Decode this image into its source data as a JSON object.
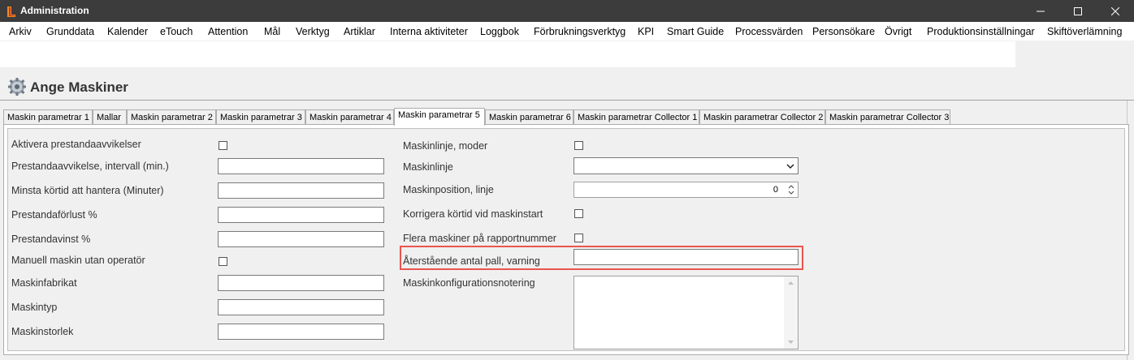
{
  "window": {
    "title": "Administration"
  },
  "menu": {
    "items": [
      "Arkiv",
      "Grunddata",
      "Kalender",
      "eTouch",
      "Attention",
      "Mål",
      "Verktyg",
      "Artiklar",
      "Interna aktiviteter",
      "Loggbok",
      "Förbrukningsverktyg",
      "KPI",
      "Smart Guide",
      "Processvärden",
      "Personsökare",
      "Övrigt",
      "Produktionsinställningar",
      "Skiftöverlämning"
    ]
  },
  "page": {
    "title": "Ange Maskiner"
  },
  "tabs": {
    "items": [
      "Maskin parametrar 1",
      "Mallar",
      "Maskin parametrar 2",
      "Maskin parametrar 3",
      "Maskin parametrar 4",
      "Maskin parametrar 5",
      "Maskin parametrar 6",
      "Maskin parametrar Collector 1",
      "Maskin parametrar Collector 2",
      "Maskin parametrar Collector 3"
    ],
    "active": "Maskin parametrar 5"
  },
  "left": {
    "aktivera": "Aktivera prestandaavvikelser",
    "intervall": "Prestandaavvikelse, intervall (min.)",
    "minsta": "Minsta körtid att hantera (Minuter)",
    "forlust": "Prestandaförlust %",
    "vinst": "Prestandavinst %",
    "manuell": "Manuell maskin utan operatör",
    "fabrikat": "Maskinfabrikat",
    "typ": "Maskintyp",
    "storlek": "Maskinstorlek"
  },
  "right": {
    "moder": "Maskinlinje, moder",
    "linje": "Maskinlinje",
    "position": "Maskinposition, linje",
    "position_value": "0",
    "korrigera": "Korrigera körtid vid maskinstart",
    "flera": "Flera maskiner på rapportnummer",
    "aterstaende": "Återstående antal pall, varning",
    "notering": "Maskinkonfigurationsnotering"
  },
  "colors": {
    "titlebar": "#3c3c3c",
    "highlight": "#e8554e"
  }
}
